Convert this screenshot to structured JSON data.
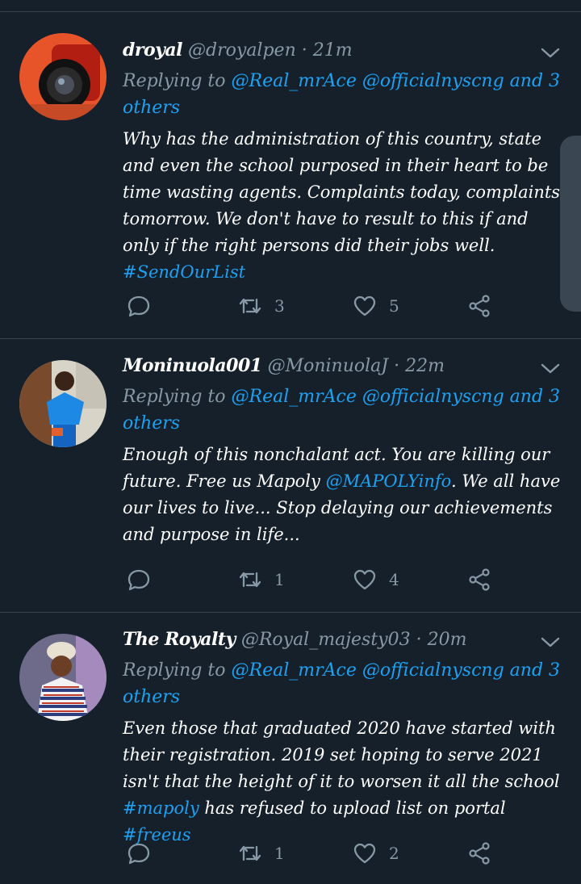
{
  "tweets": [
    {
      "name": "droyal",
      "handle": "@droyalpen",
      "dot": "·",
      "time": "21m",
      "replying_prefix": "Replying to ",
      "mentions": "@Real_mrAce @officialnyscng and 3 others",
      "body_parts": [
        {
          "text": "Why has the administration of this country, state and even the school purposed in their heart to be time wasting agents. Complaints today, complaints tomorrow. We don't have to result to this if and only if the right persons did their jobs well.",
          "link": false
        },
        {
          "text": "#SendOurList",
          "link": true,
          "break_before": true
        }
      ],
      "retweets": "3",
      "likes": "5"
    },
    {
      "name": "Moninuola001",
      "handle": "@MoninuolaJ",
      "dot": "·",
      "time": "22m",
      "replying_prefix": "Replying to ",
      "mentions": "@Real_mrAce @officialnyscng and 3 others",
      "body_parts": [
        {
          "text": "Enough of this nonchalant act. You are killing our future. Free us Mapoly ",
          "link": false
        },
        {
          "text": "@MAPOLYinfo",
          "link": true
        },
        {
          "text": ". We all have our lives to live... Stop delaying our achievements and purpose in life...",
          "link": false
        }
      ],
      "retweets": "1",
      "likes": "4"
    },
    {
      "name": "The Royalty",
      "handle": "@Royal_majesty03",
      "dot": "·",
      "time": "20m",
      "replying_prefix": "Replying to ",
      "mentions": "@Real_mrAce @officialnyscng and 3 others",
      "body_parts": [
        {
          "text": "Even those that graduated 2020 have started with their registration. 2019 set hoping to serve 2021 isn't that the height of it to worsen it all the school ",
          "link": false
        },
        {
          "text": "#mapoly",
          "link": true
        },
        {
          "text": " has refused to upload list on portal ",
          "link": false
        },
        {
          "text": "#freeus",
          "link": true
        }
      ],
      "retweets": "1",
      "likes": "2"
    }
  ],
  "icons": {
    "reply": "reply-icon",
    "retweet": "retweet-icon",
    "like": "heart-icon",
    "share": "share-icon",
    "more": "chevron-down-icon"
  },
  "colors": {
    "background": "#15202b",
    "link": "#1da1f2",
    "muted": "#8899a6",
    "divider": "#38444d"
  }
}
